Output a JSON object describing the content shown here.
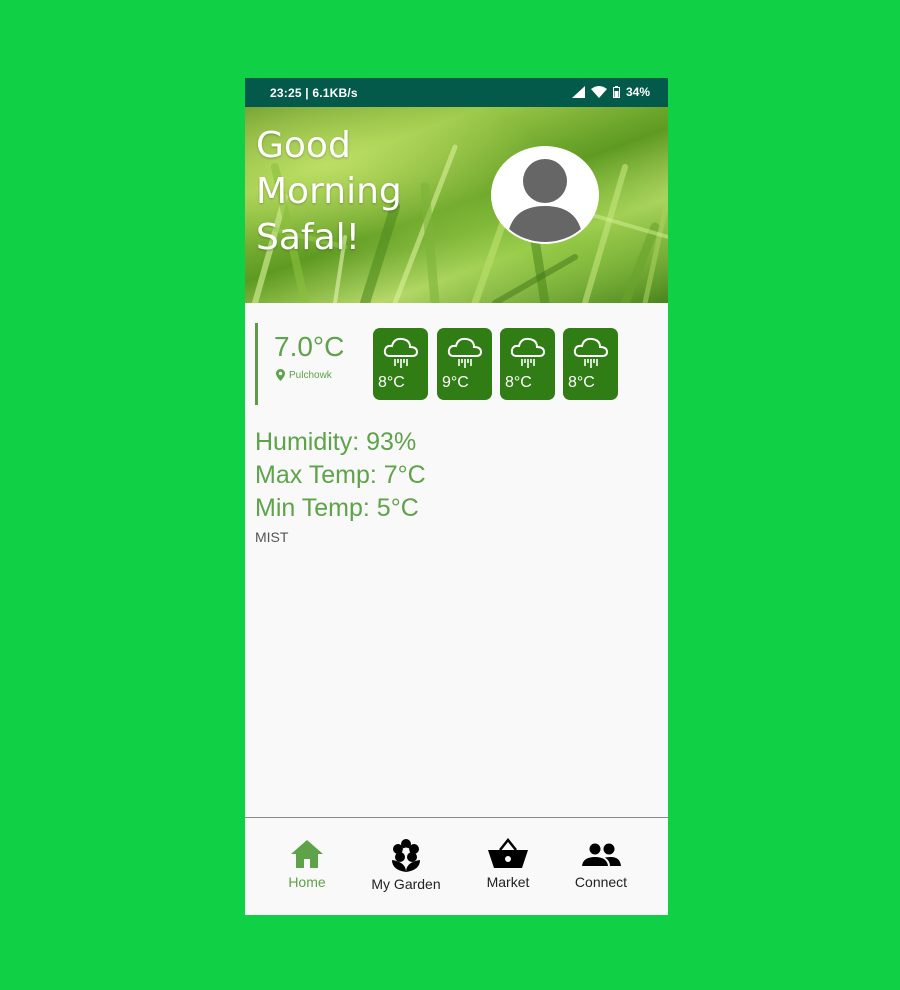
{
  "status_bar": {
    "time_speed": "23:25 | 6.1KB/s",
    "battery": "34%"
  },
  "header": {
    "greeting": "Good\nMorning\nSafal!"
  },
  "weather": {
    "current_temp": "7.0°C",
    "location": "Pulchowk",
    "forecast": [
      {
        "temp": "8°C",
        "icon": "rain-cloud-icon"
      },
      {
        "temp": "9°C",
        "icon": "rain-cloud-icon"
      },
      {
        "temp": "8°C",
        "icon": "rain-cloud-icon"
      },
      {
        "temp": "8°C",
        "icon": "rain-cloud-icon"
      }
    ],
    "humidity": "Humidity: 93%",
    "max_temp": "Max Temp: 7°C",
    "min_temp": "Min Temp: 5°C",
    "condition": "MIST"
  },
  "nav": {
    "home": "Home",
    "garden": "My Garden",
    "market": "Market",
    "connect": "Connect"
  },
  "colors": {
    "accent": "#5ea24a",
    "card": "#2f7d14",
    "status_bar": "#03594a",
    "background": "#10d146"
  }
}
